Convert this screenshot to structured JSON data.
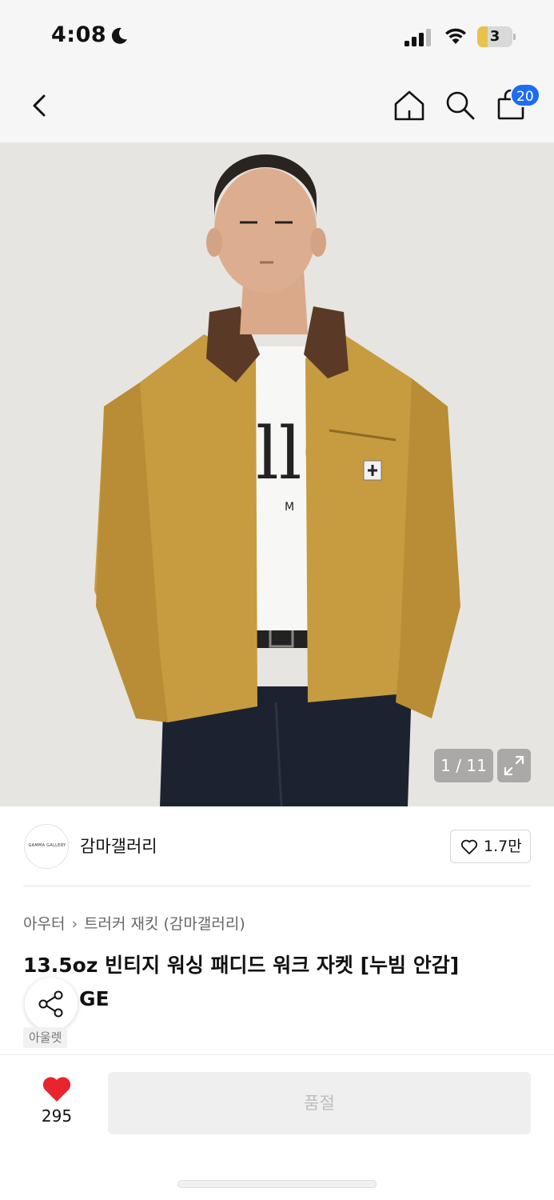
{
  "status_bar": {
    "time": "4:08",
    "battery_level": "3",
    "battery_fraction": 0.3,
    "battery_color": "#e8c24a"
  },
  "nav": {
    "cart_count": "20",
    "badge_color": "#1f6cf2",
    "icons": [
      "back-icon",
      "home-icon",
      "search-icon",
      "shopping-bag-icon"
    ]
  },
  "product_image": {
    "counter": "1 / 11",
    "description_icons": [
      "expand-icon"
    ]
  },
  "brand": {
    "logo_text": "GAMMA GALLERY",
    "name": "감마갤러리",
    "likes": "1.7만"
  },
  "breadcrumb": {
    "category": "아우터",
    "subcategory": "트러커 재킷 (감마갤러리)"
  },
  "product": {
    "title_line1": "13.5oz 빈티지 워싱 패디드 워크 자켓 [누빔 안감]",
    "title_line2": "GE",
    "tag": "아울렛"
  },
  "bottom_bar": {
    "wish_count": "295",
    "heart_color": "#e8242c",
    "buy_button_label": "품절"
  }
}
